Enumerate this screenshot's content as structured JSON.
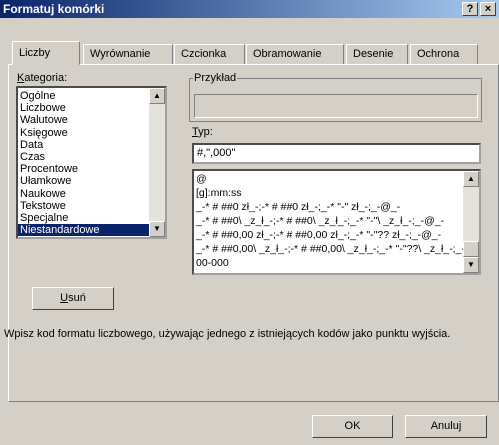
{
  "window": {
    "title": "Formatuj komórki",
    "help_label": "?",
    "close_label": "×"
  },
  "tabs": [
    {
      "label": "Liczby",
      "active": true
    },
    {
      "label": "Wyrównanie"
    },
    {
      "label": "Czcionka"
    },
    {
      "label": "Obramowanie"
    },
    {
      "label": "Desenie"
    },
    {
      "label": "Ochrona"
    }
  ],
  "category": {
    "label": "Kategoria:",
    "items": [
      "Ogólne",
      "Liczbowe",
      "Walutowe",
      "Księgowe",
      "Data",
      "Czas",
      "Procentowe",
      "Ułamkowe",
      "Naukowe",
      "Tekstowe",
      "Specjalne",
      "Niestandardowe"
    ],
    "selected": "Niestandardowe"
  },
  "sample": {
    "label": "Przykład"
  },
  "type": {
    "label": "Typ:",
    "value": "#,\",000\"",
    "formats": [
      "@",
      "[g]:mm:ss",
      "_-* # ##0 zł_-;-* # ##0 zł_-;_-* \"-\" zł_-;_-@_-",
      "_-* # ##0\\ _z_ł_-;-* # ##0\\ _z_ł_-;_-* \"-\"\\ _z_ł_-;_-@_-",
      "_-* # ##0,00 zł_-;-* # ##0,00 zł_-;_-* \"-\"?? zł_-;_-@_-",
      "_-* # ##0,00\\ _z_ł_-;-* # ##0,00\\ _z_ł_-;_-* \"-\"??\\ _z_ł_-;_-@_-",
      "00-000"
    ]
  },
  "delete_button": "Usuń",
  "description": "Wpisz kod formatu liczbowego, używając jednego z istniejących kodów jako punktu wyjścia.",
  "ok_button": "OK",
  "cancel_button": "Anuluj"
}
